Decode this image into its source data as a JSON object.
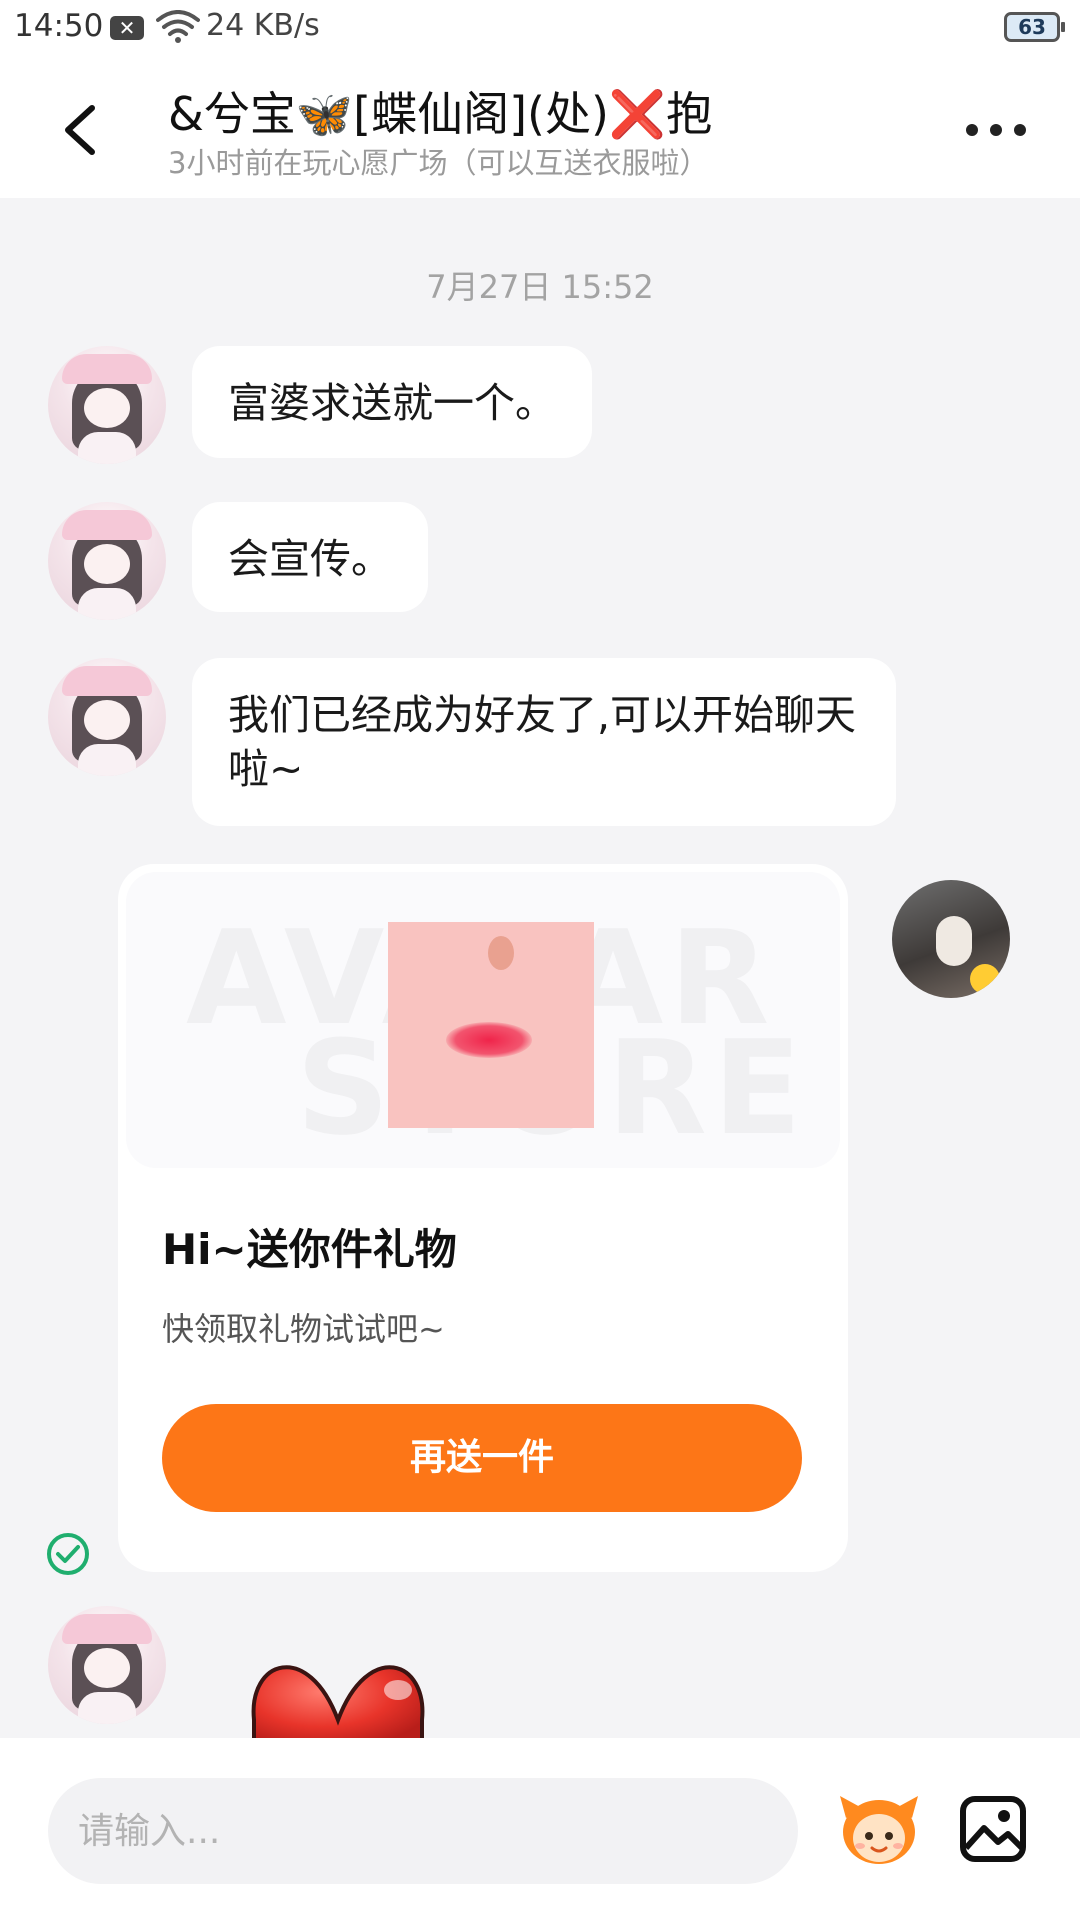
{
  "status_bar": {
    "time": "14:50",
    "notif_icon": "x-box-icon",
    "network_speed": "24 KB/s",
    "battery": "63"
  },
  "header": {
    "title": "&兮宝🦋[蝶仙阁](处)❌抱",
    "subtitle": "3小时前在玩心愿广场（可以互送衣服啦）",
    "back_icon": "back-arrow-icon",
    "more_icon": "more-dots-icon"
  },
  "chat": {
    "timestamp": "7月27日 15:52",
    "messages": [
      {
        "side": "left",
        "text": "富婆求送就一个。"
      },
      {
        "side": "left",
        "text": "会宣传。"
      },
      {
        "side": "left",
        "text": "我们已经成为好友了,可以开始聊天啦~"
      }
    ],
    "gift_card": {
      "title": "Hi~送你件礼物",
      "description": "快领取礼物试试吧~",
      "button_label": "再送一件",
      "watermark_line1": "AVATAR",
      "watermark_line2": "STORE"
    },
    "sent_status_icon": "check-circle-icon",
    "sticker": "heart-sticker"
  },
  "input_bar": {
    "placeholder": "请输入...",
    "mascot_icon": "mascot-icon",
    "image_icon": "image-icon"
  },
  "colors": {
    "accent": "#fd7617",
    "background": "#f4f4f6",
    "bubble": "#ffffff"
  }
}
